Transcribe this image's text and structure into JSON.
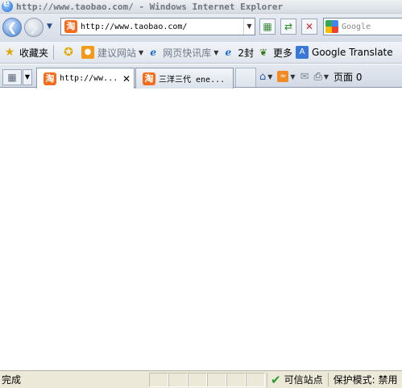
{
  "window": {
    "title": "http://www.taobao.com/ - Windows Internet Explorer"
  },
  "address_bar": {
    "url": "http://www.taobao.com/",
    "favicon_text": "淘"
  },
  "search": {
    "placeholder": "Google"
  },
  "favorites_bar": {
    "favorites_label": "收藏夹",
    "items": [
      {
        "label": "建议网站",
        "icon": "suggested-sites-icon"
      },
      {
        "label": "网页快讯库",
        "icon": "ie-icon"
      },
      {
        "label": "2封",
        "icon": "ie-icon"
      },
      {
        "label": "更多",
        "icon": "leaf-icon"
      },
      {
        "label": "Google Translate",
        "icon": "google-translate-icon"
      }
    ]
  },
  "tabs": {
    "items": [
      {
        "label": "http://ww...",
        "favicon": "淘",
        "active": true
      },
      {
        "label": "三洋三代 ene...",
        "favicon": "淘",
        "active": false
      }
    ]
  },
  "command_bar": {
    "page_label": "页面 0"
  },
  "status_bar": {
    "text": "完成",
    "zone": "可信站点",
    "protected_mode": "保护模式: 禁用"
  }
}
